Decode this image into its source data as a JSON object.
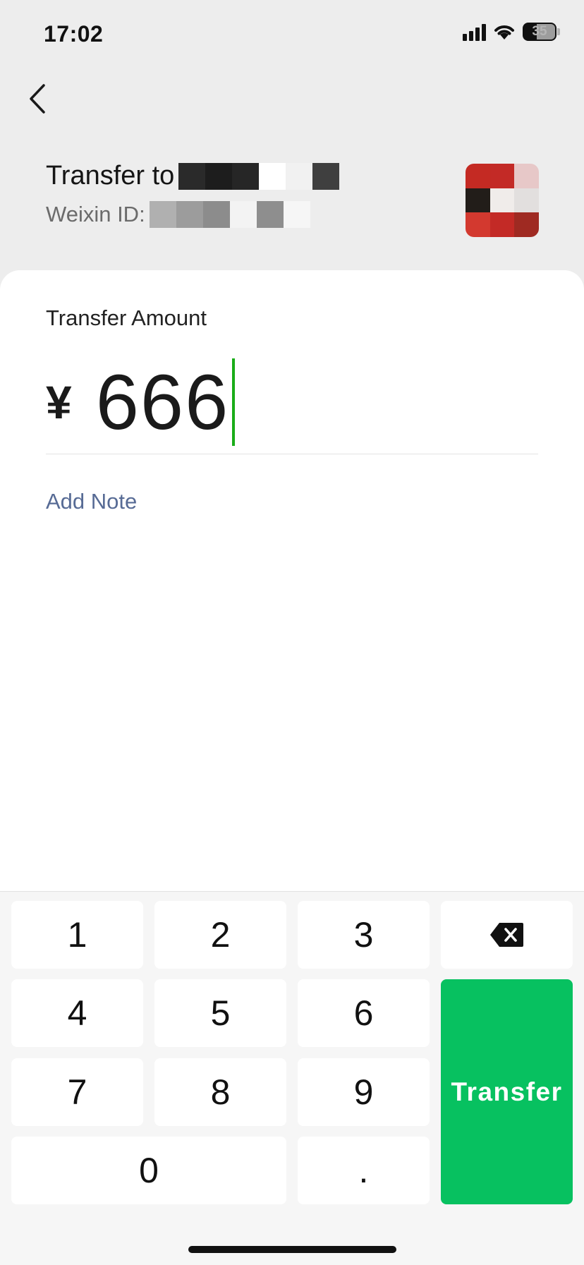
{
  "status_bar": {
    "time": "17:02",
    "battery": "35",
    "icons": [
      "cellular-signal-icon",
      "wifi-icon",
      "battery-icon"
    ]
  },
  "nav": {
    "back_icon": "chevron-left-icon"
  },
  "recipient": {
    "transfer_prefix": "Transfer to",
    "weixin_id_prefix": "Weixin ID: ",
    "name_mosaic": [
      "#2a2a2a",
      "#1d1d1d",
      "#262626",
      "#ffffff",
      "#f1f1f1",
      "#3f3f3f"
    ],
    "id_mosaic": [
      "#b0b0b0",
      "#9c9c9c",
      "#8c8c8c",
      "#f3f3f3",
      "#8e8e8e",
      "#f6f6f6"
    ],
    "avatar_mosaic": [
      "#c42a23",
      "#c32a26",
      "#e7c8c8",
      "#221d19",
      "#f0ecea",
      "#e2dfde",
      "#d3392f",
      "#c32a26",
      "#9f2a22"
    ]
  },
  "amount": {
    "label": "Transfer Amount",
    "currency": "¥",
    "value": "666"
  },
  "note": {
    "label": "Add Note"
  },
  "keypad": {
    "keys": [
      "1",
      "2",
      "3",
      "4",
      "5",
      "6",
      "7",
      "8",
      "9",
      "0",
      "."
    ],
    "backspace_icon": "backspace-icon",
    "transfer_label": "Transfer"
  },
  "colors": {
    "accent_green": "#07c160",
    "cursor_green": "#1aad19",
    "link_blue": "#576b95",
    "background": "#ededed"
  }
}
